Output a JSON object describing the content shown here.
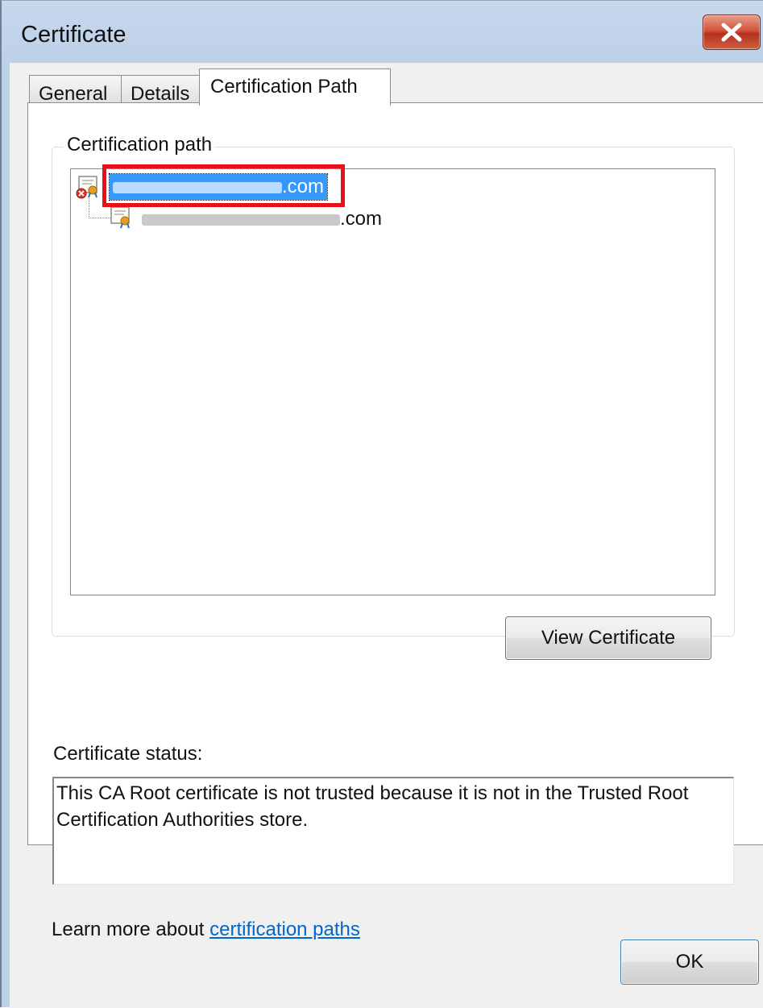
{
  "window": {
    "title": "Certificate"
  },
  "tabs": [
    {
      "label": "General"
    },
    {
      "label": "Details"
    },
    {
      "label": "Certification Path"
    }
  ],
  "path_group": {
    "legend": "Certification path",
    "nodes": [
      {
        "suffix": ".com",
        "selected": true,
        "icon": "certificate-error-icon"
      },
      {
        "suffix": ".com",
        "selected": false,
        "icon": "certificate-icon"
      }
    ]
  },
  "buttons": {
    "view_certificate": "View Certificate",
    "ok": "OK"
  },
  "status": {
    "label": "Certificate status:",
    "text": "This CA Root certificate is not trusted because it is not in the Trusted Root Certification Authorities store."
  },
  "learn_more": {
    "prefix": "Learn more about ",
    "link": "certification paths"
  },
  "colors": {
    "selection": "#3399ff",
    "highlight_box": "#e8101a",
    "link": "#0066cc",
    "close_button": "#c8452f"
  }
}
